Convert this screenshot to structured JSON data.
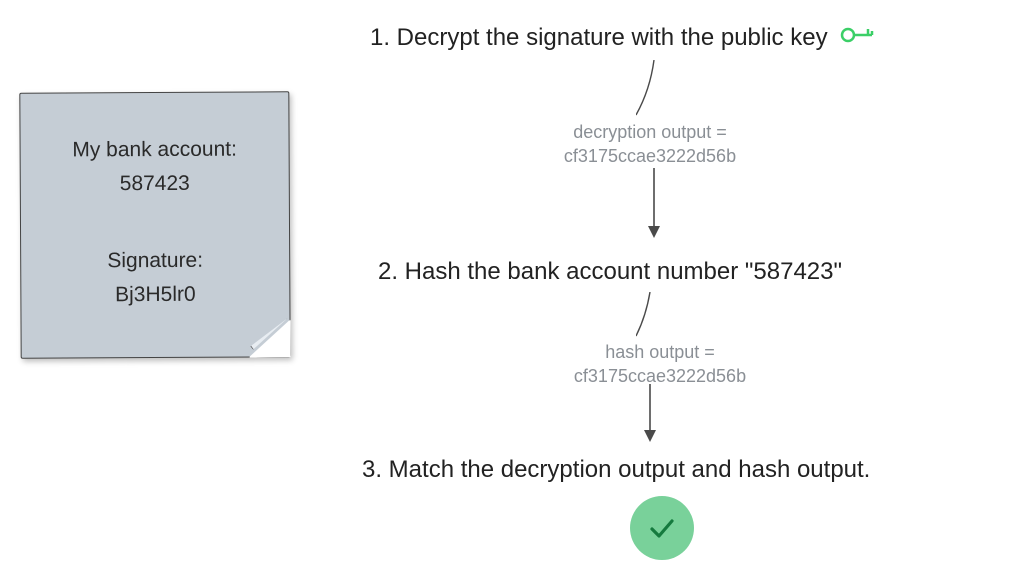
{
  "note": {
    "line1": "My bank account:",
    "account": "587423",
    "line3": "Signature:",
    "signature": "Bj3H5lr0"
  },
  "steps": {
    "s1": "1. Decrypt the signature with the public key",
    "s2": "2. Hash the bank account number \"587423\"",
    "s3": "3. Match the decryption output and hash output."
  },
  "outputs": {
    "decrypt_label": "decryption output =",
    "decrypt_value": "cf3175ccae3222d56b",
    "hash_label": "hash output =",
    "hash_value": "cf3175ccae3222d56b"
  },
  "colors": {
    "accent_green": "#3bcf67",
    "note_bg": "#c5cdd5",
    "muted": "#8a8f95"
  }
}
